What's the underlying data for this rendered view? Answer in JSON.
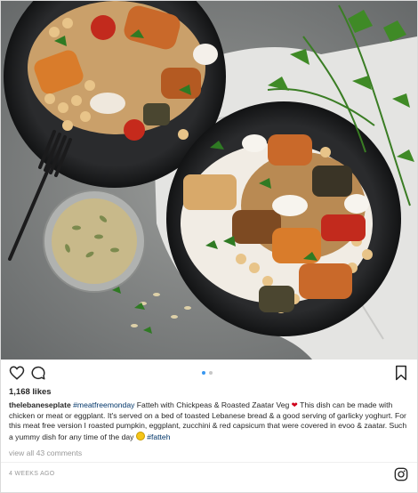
{
  "post": {
    "photo_alt": "Fatteh with Chickpeas & Roasted Zaatar Veg",
    "carousel": {
      "pages": 2,
      "current": 1
    },
    "likes": "1,168 likes",
    "caption": {
      "username": "thelebaneseplate",
      "hashtag1": "#meatfreemonday",
      "text1": " Fatteh with Chickpeas & Roasted Zaatar Veg ",
      "heart": "❤",
      "text2": " This dish can be made with chicken or meat or eggplant. It's served on a bed of toasted Lebanese bread & a good serving of garlicky yoghurt. For this meat free version I roasted pumpkin, eggplant, zucchini & red capsicum that were covered in evoo & zaatar. Such a yummy dish for any time of the day ",
      "hashtag2": "#fatteh"
    },
    "comments_link": "view all 43 comments",
    "timestamp": "4 WEEKS AGO"
  },
  "icons": {
    "like": "heart-outline-icon",
    "comment": "speech-bubble-icon",
    "save": "bookmark-icon",
    "brand": "instagram-icon"
  },
  "colors": {
    "link": "#003569",
    "dot_active": "#3897f0",
    "heart": "#d0021b"
  }
}
